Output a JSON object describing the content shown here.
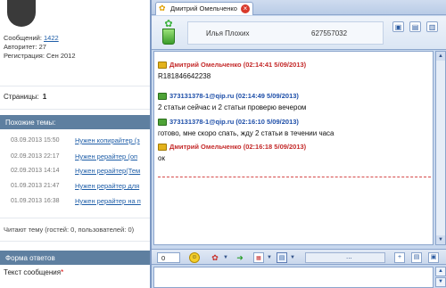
{
  "forum": {
    "profile": {
      "posts_label": "Сообщений:",
      "posts_value": "1422",
      "authority": "Авторитет: 27",
      "registered": "Регистрация: Сен 2012"
    },
    "pages_label": "Страницы:",
    "pages_value": "1",
    "similar_header": "Похожие темы:",
    "similar_topics": [
      {
        "date": "03.09.2013 15:50",
        "title": "Нужен копирайтер (з"
      },
      {
        "date": "02.09.2013 22:17",
        "title": "Нужен рерайтер (оп"
      },
      {
        "date": "02.09.2013 14:14",
        "title": "Нужен рерайтер(Тем"
      },
      {
        "date": "01.09.2013 21:47",
        "title": "Нужен рерайтер для"
      },
      {
        "date": "01.09.2013 16:38",
        "title": "Нужен рерайтер на п"
      }
    ],
    "readers_text": "Читают тему (гостей: 0, пользователей: 0)",
    "form_header": "Форма ответов",
    "message_label": "Текст сообщения",
    "required_mark": "*"
  },
  "chat": {
    "tab_title": "Дмитрий Омельченко",
    "contact_name": "Илья Плохих",
    "contact_uin": "627557032",
    "messages": [
      {
        "author": "Дмитрий Омельченко (02:14:41 5/09/2013)",
        "text": "R181846642238"
      },
      {
        "author": "373131378-1@qip.ru (02:14:49 5/09/2013)",
        "text": "2 статьи сейчас и 2 статьи проверю вечером"
      },
      {
        "author": "373131378-1@qip.ru (02:16:10 5/09/2013)",
        "text": "готово, мне скоро спать, жду 2 статьи в течении часа"
      },
      {
        "author": "Дмитрий Омельченко (02:16:18 5/09/2013)",
        "text": "ок"
      }
    ],
    "char_counter": "0",
    "more_dots": "...",
    "colors": {
      "own_author": "#c42a2a",
      "peer_author": "#1d4ea8",
      "window_frame": "#8ba5cc",
      "forum_bar": "#5e7fa0"
    }
  }
}
